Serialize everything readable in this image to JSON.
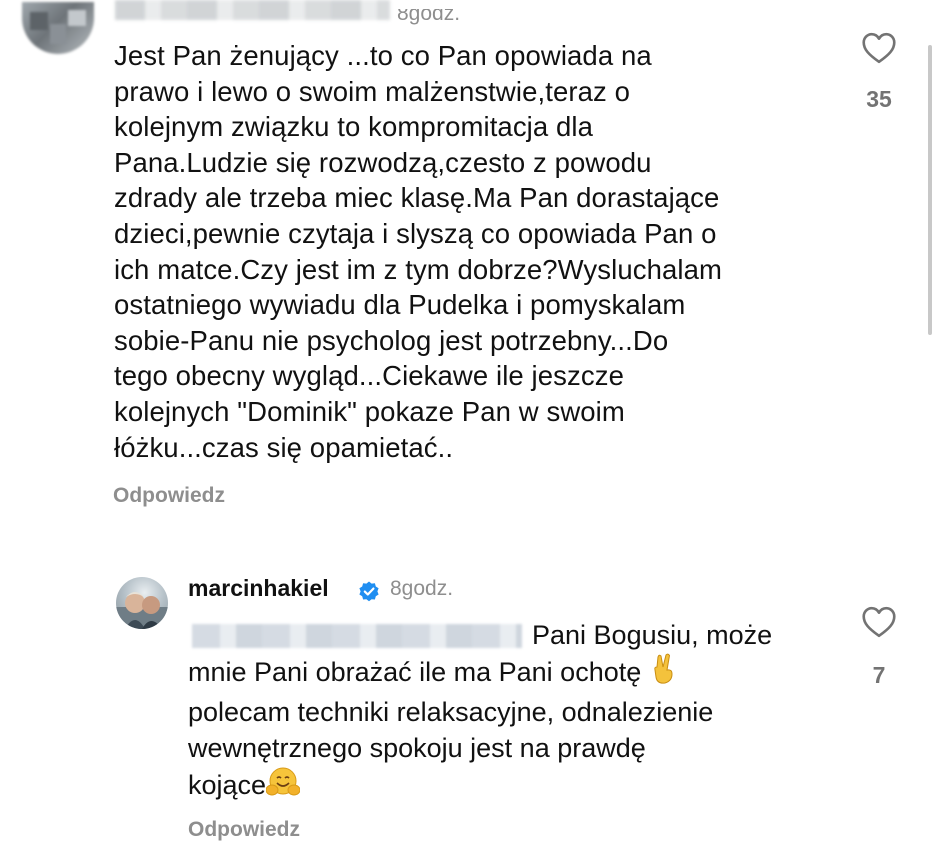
{
  "comment1": {
    "time": "8godz.",
    "text": "Jest Pan żenujący ...to co Pan opowiada na\nprawo i lewo o swoim malżenstwie,teraz o\nkolejnym związku to kompromitacja dla\nPana.Ludzie się rozwodzą,czesto z powodu\nzdrady ale trzeba miec klasę.Ma Pan dorastające\ndzieci,pewnie czytaja i slyszą co opowiada Pan o\nich matce.Czy jest im z tym dobrze?Wysluchalam\nostatniego wywiadu dla Pudelka i pomyskalam\nsobie-Panu nie psycholog jest potrzebny...Do\ntego obecny wygląd...Ciekawe ile jeszcze\nkolejnych \"Dominik\" pokaze Pan w swoim\nłóżku...czas się opamietać..",
    "reply_label": "Odpowiedz",
    "likes": "35"
  },
  "comment2": {
    "username": "marcinhakiel",
    "time": "8godz.",
    "text_first": "Pani Bogusiu, może",
    "text_rest_1": "mnie Pani obrażać ile ma Pani ochotę ",
    "emoji_1": "victory-hand-emoji",
    "text_rest_2": "\npolecam techniki relaksacyjne, odnalezienie\nwewnętrznego spokoju jest na prawdę\nkojące",
    "emoji_2": "hugging-face-emoji",
    "reply_label": "Odpowiedz",
    "likes": "7"
  },
  "colors": {
    "text": "#111111",
    "muted": "#8e8e8e",
    "verified": "#1f8ef1"
  }
}
